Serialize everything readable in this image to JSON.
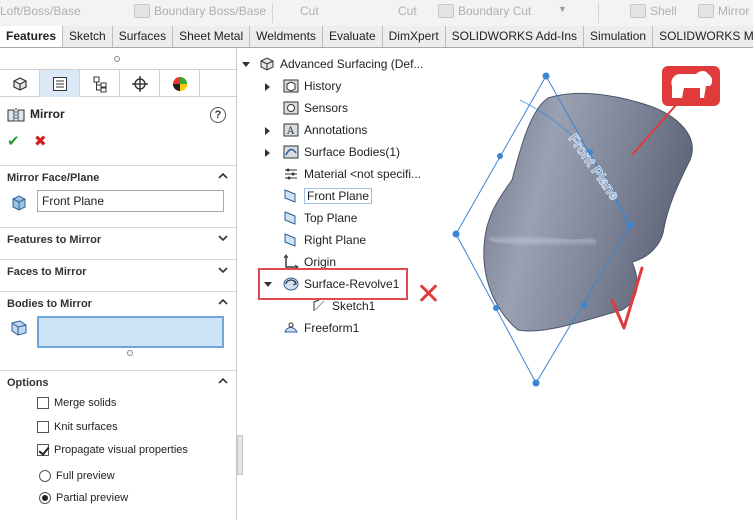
{
  "ribbon": {
    "items": [
      {
        "label": "Loft/Boss/Base"
      },
      {
        "label": "Boundary Boss/Base"
      },
      {
        "label": "Cut"
      },
      {
        "label": "Cut"
      },
      {
        "label": "Boundary Cut"
      },
      {
        "label": "Shell"
      },
      {
        "label": "Mirror"
      }
    ]
  },
  "tabs": [
    {
      "label": "Features"
    },
    {
      "label": "Sketch"
    },
    {
      "label": "Surfaces"
    },
    {
      "label": "Sheet Metal"
    },
    {
      "label": "Weldments"
    },
    {
      "label": "Evaluate"
    },
    {
      "label": "DimXpert"
    },
    {
      "label": "SOLIDWORKS Add-Ins"
    },
    {
      "label": "Simulation"
    },
    {
      "label": "SOLIDWORKS MBD"
    }
  ],
  "property_manager": {
    "title": "Mirror",
    "help": "?",
    "ok": "✔",
    "cancel": "✖",
    "sections": {
      "mirror_face": {
        "label": "Mirror Face/Plane",
        "value": "Front Plane"
      },
      "features": {
        "label": "Features to Mirror"
      },
      "faces": {
        "label": "Faces to Mirror"
      },
      "bodies": {
        "label": "Bodies to Mirror",
        "value": ""
      },
      "options": {
        "label": "Options",
        "merge_solids": {
          "label": "Merge solids",
          "checked": false
        },
        "knit_surfaces": {
          "label": "Knit surfaces",
          "checked": false
        },
        "propagate": {
          "label": "Propagate visual properties",
          "checked": true
        },
        "full_preview": {
          "label": "Full preview",
          "selected": false
        },
        "partial_preview": {
          "label": "Partial preview",
          "selected": true
        }
      }
    }
  },
  "tree": {
    "root": "Advanced Surfacing  (Def...",
    "items": [
      {
        "label": "History"
      },
      {
        "label": "Sensors"
      },
      {
        "label": "Annotations"
      },
      {
        "label": "Surface Bodies(1)"
      },
      {
        "label": "Material <not specifi..."
      },
      {
        "label": "Front Plane"
      },
      {
        "label": "Top Plane"
      },
      {
        "label": "Right Plane"
      },
      {
        "label": "Origin"
      },
      {
        "label": "Surface-Revolve1"
      },
      {
        "label": "Sketch1"
      },
      {
        "label": "Freeform1"
      }
    ]
  },
  "viewport": {
    "plane_label": "Front Plane",
    "wrong_mark": "✕",
    "right_mark": "✓",
    "colors": {
      "surface": "#7d8497",
      "plane": "#3a86d4",
      "annotation": "#e03a3a"
    }
  }
}
